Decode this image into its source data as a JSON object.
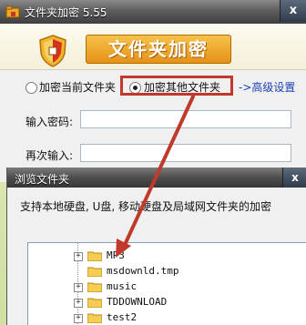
{
  "app": {
    "title": "文件夹加密 5.55",
    "banner_title": "文件夹加密",
    "close_glyph": "x",
    "mode_options": [
      {
        "label": "加密当前文件夹",
        "checked": false
      },
      {
        "label": "加密其他文件夹",
        "checked": true
      }
    ],
    "advanced_link": "->高级设置",
    "fields": [
      {
        "label": "输入密码:",
        "value": ""
      },
      {
        "label": "再次输入:",
        "value": ""
      }
    ]
  },
  "dialog": {
    "title": "浏览文件夹",
    "close_glyph": "x",
    "description": "支持本地硬盘, U盘, 移动硬盘及局域网文件夹的加密",
    "tree": [
      {
        "name": "MP3",
        "expandable": true
      },
      {
        "name": "msdownld.tmp",
        "expandable": false
      },
      {
        "name": "music",
        "expandable": true
      },
      {
        "name": "TDDOWNLOAD",
        "expandable": true
      },
      {
        "name": "test2",
        "expandable": true
      }
    ]
  },
  "colors": {
    "highlight": "#c0392b",
    "banner_orange": "#e59216",
    "link": "#1a3fb8"
  },
  "icons": {
    "app": "lock-folder-icon",
    "banner": "shield-icon",
    "folder": "folder-icon"
  }
}
